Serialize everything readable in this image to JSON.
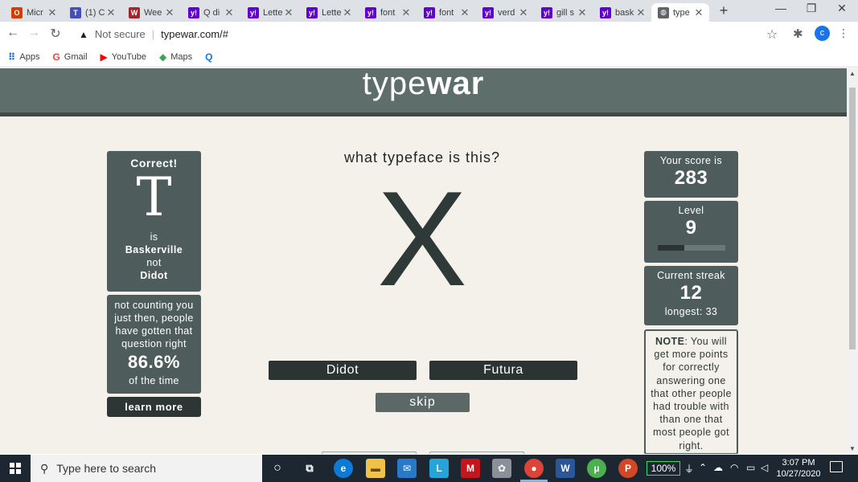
{
  "browser": {
    "tabs": [
      {
        "title": "Micr",
        "favicon": "office-icon",
        "color": "#d83b01",
        "glyph": "O"
      },
      {
        "title": "(1) C",
        "favicon": "teams-icon",
        "color": "#464eb8",
        "glyph": "T"
      },
      {
        "title": "Wee",
        "favicon": "book-icon",
        "color": "#a4262c",
        "glyph": "W"
      },
      {
        "title": "Q di",
        "favicon": "yahoo-icon",
        "color": "#6001d2",
        "glyph": "y!"
      },
      {
        "title": "Lette",
        "favicon": "yahoo-icon",
        "color": "#6001d2",
        "glyph": "y!"
      },
      {
        "title": "Lette",
        "favicon": "yahoo-icon",
        "color": "#6001d2",
        "glyph": "y!"
      },
      {
        "title": "font",
        "favicon": "yahoo-icon",
        "color": "#6001d2",
        "glyph": "y!"
      },
      {
        "title": "font",
        "favicon": "yahoo-icon",
        "color": "#6001d2",
        "glyph": "y!"
      },
      {
        "title": "verd",
        "favicon": "yahoo-icon",
        "color": "#6001d2",
        "glyph": "y!"
      },
      {
        "title": "gill s",
        "favicon": "yahoo-icon",
        "color": "#6001d2",
        "glyph": "y!"
      },
      {
        "title": "bask",
        "favicon": "yahoo-icon",
        "color": "#6001d2",
        "glyph": "y!"
      },
      {
        "title": "type",
        "favicon": "globe-icon",
        "color": "#5f6368",
        "glyph": "◍",
        "active": true
      }
    ],
    "security_label": "Not secure",
    "url": "typewar.com/#",
    "avatar_letter": "c",
    "bookmarks": [
      {
        "label": "Apps",
        "icon": "apps-grid-icon",
        "glyph": "⠿",
        "color": "#1a73e8"
      },
      {
        "label": "Gmail",
        "icon": "google-icon",
        "glyph": "G",
        "color": "#ea4335"
      },
      {
        "label": "YouTube",
        "icon": "youtube-icon",
        "glyph": "▶",
        "color": "#ff0000"
      },
      {
        "label": "Maps",
        "icon": "maps-icon",
        "glyph": "◆",
        "color": "#34a853"
      },
      {
        "label": "",
        "icon": "search-q-icon",
        "glyph": "Q",
        "color": "#1a73e8"
      }
    ]
  },
  "site": {
    "logo_light": "type",
    "logo_bold": "war"
  },
  "result": {
    "heading": "Correct!",
    "glyph": "T",
    "is_label": "is",
    "answer": "Baskerville",
    "not_label": "not",
    "other": "Didot"
  },
  "stats": {
    "line1": "not counting you",
    "line2": "just then, people",
    "line3": "have gotten that",
    "line4": "question right",
    "percent": "86.6%",
    "suffix": "of the time"
  },
  "learn_more": "learn more",
  "quiz": {
    "question": "what typeface is this?",
    "specimen": "X",
    "choices": [
      "Didot",
      "Futura"
    ],
    "skip": "skip"
  },
  "score": {
    "label": "Your score is",
    "value": "283"
  },
  "level": {
    "label": "Level",
    "value": "9",
    "progress": 0.4
  },
  "streak": {
    "label": "Current streak",
    "value": "12",
    "longest": "longest: 33"
  },
  "note": {
    "bold": "NOTE",
    "line1": ": You will",
    "line2": "get more points",
    "line3": "for correctly",
    "line4": "answering one",
    "line5": "that other people",
    "line6": "had trouble with",
    "line7": "than one that",
    "line8": "most people got",
    "line9": "right."
  },
  "taskbar": {
    "search_placeholder": "Type here to search",
    "battery": "100%",
    "time": "3:07 PM",
    "date": "10/27/2020"
  }
}
